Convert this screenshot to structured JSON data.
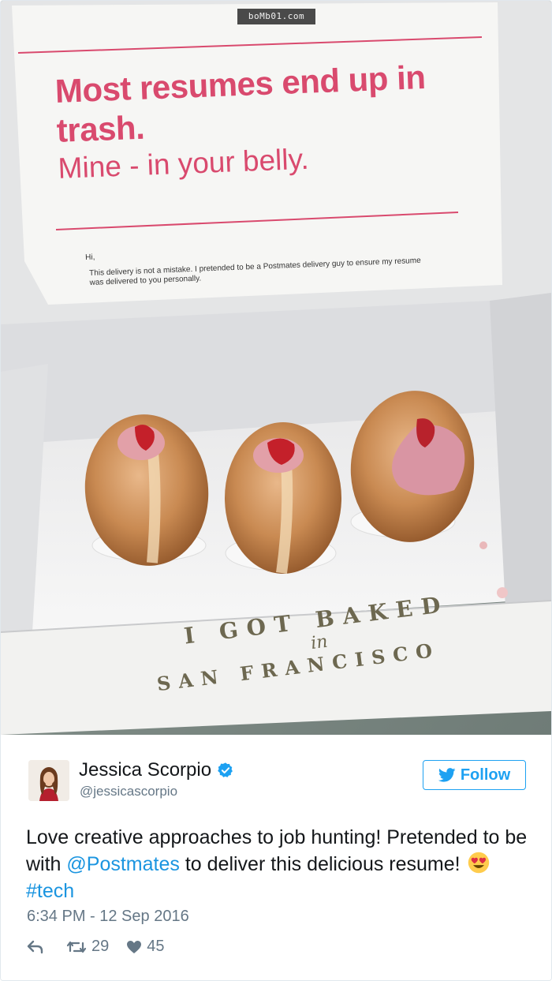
{
  "photo": {
    "watermark": "boMb01.com",
    "card": {
      "headline": "Most resumes end up in trash.",
      "subline": "Mine - in your belly.",
      "greeting": "Hi,",
      "body": "This delivery is not a mistake. I pretended to be a Postmates delivery guy to ensure my resume was delivered to you personally."
    },
    "box_print": {
      "line1": "I GOT BAKED",
      "line2": "in",
      "line3": "SAN FRANCISCO"
    }
  },
  "tweet": {
    "author": {
      "display_name": "Jessica Scorpio",
      "handle": "@jessicascorpio",
      "verified_icon": "verified-badge-icon"
    },
    "follow_label": "Follow",
    "text": {
      "part1": "Love creative approaches to job hunting! Pretended to be with ",
      "mention": "@Postmates",
      "part2": " to deliver this delicious resume! ",
      "emoji": "heart-eyes-emoji",
      "hashtag": "#tech"
    },
    "timestamp": "6:34 PM - 12 Sep 2016",
    "actions": {
      "reply_icon": "reply-icon",
      "retweet_icon": "retweet-icon",
      "retweet_count": "29",
      "like_icon": "heart-icon",
      "like_count": "45"
    },
    "colors": {
      "brand": "#1da1f2",
      "link": "#1b95e0",
      "muted": "#657786",
      "card_accent": "#d94a6e"
    }
  }
}
